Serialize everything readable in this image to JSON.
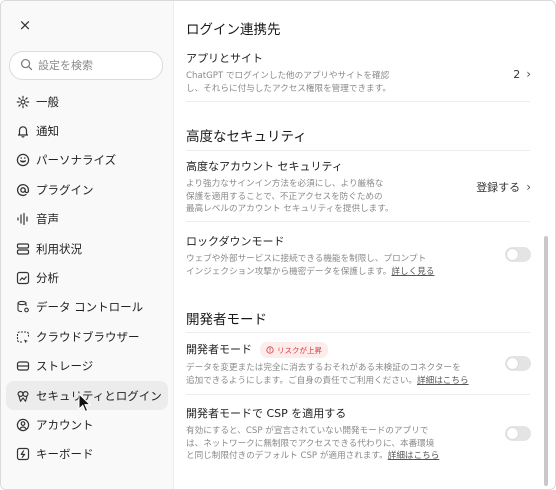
{
  "sidebar": {
    "close_label": "×",
    "search_placeholder": "設定を検索",
    "items": [
      {
        "label": "一般",
        "icon": "gear-icon"
      },
      {
        "label": "通知",
        "icon": "bell-icon"
      },
      {
        "label": "パーソナライズ",
        "icon": "personalize-icon"
      },
      {
        "label": "プラグイン",
        "icon": "at-icon"
      },
      {
        "label": "音声",
        "icon": "audio-wave-icon"
      },
      {
        "label": "利用状況",
        "icon": "usage-icon"
      },
      {
        "label": "分析",
        "icon": "chart-icon"
      },
      {
        "label": "データ コントロール",
        "icon": "data-control-icon"
      },
      {
        "label": "クラウドブラウザー",
        "icon": "cloud-browser-icon"
      },
      {
        "label": "ストレージ",
        "icon": "storage-icon"
      },
      {
        "label": "セキュリティとログイン",
        "icon": "security-icon"
      },
      {
        "label": "アカウント",
        "icon": "account-icon"
      },
      {
        "label": "キーボード",
        "icon": "keyboard-icon"
      }
    ],
    "active_index": 10
  },
  "main": {
    "login_section": {
      "title": "ログイン連携先",
      "apps": {
        "title": "アプリとサイト",
        "desc1": "ChatGPT でログインした他のアプリやサイトを確認",
        "desc2": "し、それらに付与したアクセス権限を管理できます。",
        "value": "2"
      }
    },
    "advanced_section": {
      "title": "高度なセキュリティ",
      "account_security": {
        "title": "高度なアカウント セキュリティ",
        "desc1": "より強力なサインイン方法を必須にし、より厳格な",
        "desc2": "保護を適用することで、不正アクセスを防ぐための",
        "desc3": "最高レベルのアカウント セキュリティを提供します。",
        "value": "登録する"
      },
      "lockdown": {
        "title": "ロックダウンモード",
        "desc1": "ウェブや外部サービスに接続できる機能を制限し、プロンプト",
        "desc2": "インジェクション攻撃から機密データを保護します。",
        "link": "詳しく見る",
        "enabled": false
      }
    },
    "dev_section": {
      "title": "開発者モード",
      "dev_mode": {
        "title": "開発者モード",
        "badge": "リスクが上昇",
        "desc1": "データを変更または完全に消去するおそれがある未検証のコネクターを",
        "desc2": "追加できるようにします。ご自身の責任でご利用ください。",
        "link": "詳細はこちら",
        "enabled": false
      },
      "csp": {
        "title": "開発者モードで CSP を適用する",
        "desc1": "有効にすると、CSP が宣言されていない開発モードのアプリで",
        "desc2": "は、ネットワークに無制限でアクセスできる代わりに、本番環境",
        "desc3": "と同じ制限付きのデフォルト CSP が適用されます。",
        "link": "詳細はこちら",
        "enabled": false
      }
    }
  },
  "colors": {
    "badge_bg": "#fdecec",
    "badge_text": "#d93838",
    "toggle_off": "#e4e4e4"
  }
}
